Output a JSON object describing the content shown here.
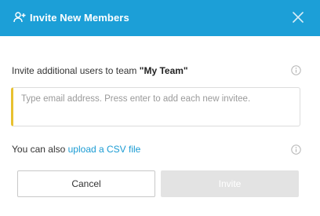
{
  "header": {
    "title": "Invite New Members",
    "background": "#1c9fd7",
    "icon": "add-user-icon",
    "close_icon": "close-icon"
  },
  "invite": {
    "prefix": "Invite additional users to team ",
    "team_name": "\"My Team\"",
    "info_icon": "info-icon"
  },
  "email_input": {
    "placeholder": "Type email address. Press enter to add each new invitee.",
    "value": "",
    "accent_color": "#e8c12f"
  },
  "csv": {
    "prefix": "You can also ",
    "link_label": "upload a CSV file",
    "link_color": "#1a9bd3",
    "info_icon": "info-icon"
  },
  "buttons": {
    "cancel_label": "Cancel",
    "invite_label": "Invite",
    "invite_disabled": true
  }
}
